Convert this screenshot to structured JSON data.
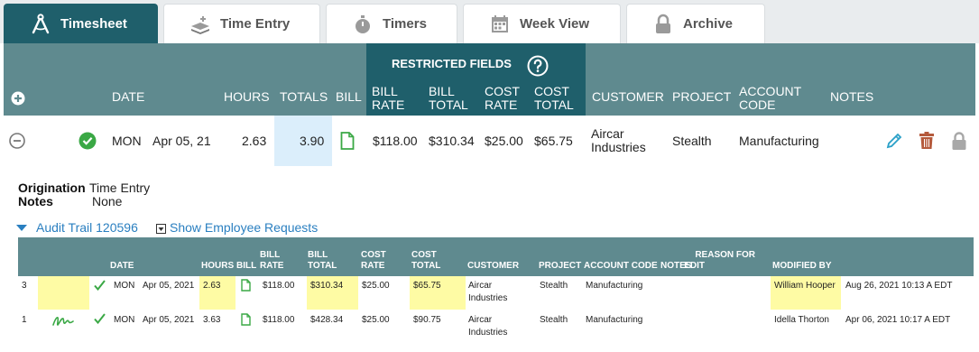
{
  "tabs": [
    {
      "label": "Timesheet",
      "icon": "compass-icon",
      "active": true
    },
    {
      "label": "Time Entry",
      "icon": "time-entry-icon",
      "active": false
    },
    {
      "label": "Timers",
      "icon": "stopwatch-icon",
      "active": false
    },
    {
      "label": "Week View",
      "icon": "calendar-icon",
      "active": false
    },
    {
      "label": "Archive",
      "icon": "lock-icon",
      "active": false
    }
  ],
  "header": {
    "restricted_title": "RESTRICTED FIELDS",
    "columns": {
      "date": "DATE",
      "hours": "HOURS",
      "totals": "TOTALS",
      "bill": "BILL",
      "bill_rate_1": "BILL",
      "bill_rate_2": "RATE",
      "bill_total_1": "BILL",
      "bill_total_2": "TOTAL",
      "cost_rate_1": "COST",
      "cost_rate_2": "RATE",
      "cost_total_1": "COST",
      "cost_total_2": "TOTAL",
      "customer": "CUSTOMER",
      "project": "PROJECT",
      "account_code_1": "ACCOUNT",
      "account_code_2": "CODE",
      "notes": "NOTES"
    }
  },
  "entry": {
    "day": "MON",
    "date": "Apr 05, 21",
    "hours": "2.63",
    "totals": "3.90",
    "bill_rate": "$118.00",
    "bill_total": "$310.34",
    "cost_rate": "$25.00",
    "cost_total": "$65.75",
    "customer_1": "Aircar",
    "customer_2": "Industries",
    "project": "Stealth",
    "account_code": "Manufacturing"
  },
  "details": {
    "origination_label": "Origination",
    "origination_value": "Time Entry",
    "notes_label": "Notes",
    "notes_value": "None",
    "audit_trail_link": "Audit Trail 120596",
    "employee_requests_link": "Show Employee Requests"
  },
  "audit": {
    "columns": {
      "date": "DATE",
      "hours": "HOURS",
      "bill": "BILL",
      "bill_rate_1": "BILL",
      "bill_rate_2": "RATE",
      "bill_total_1": "BILL",
      "bill_total_2": "TOTAL",
      "cost_rate_1": "COST",
      "cost_rate_2": "RATE",
      "cost_total_1": "COST",
      "cost_total_2": "TOTAL",
      "customer": "CUSTOMER",
      "project": "PROJECT",
      "account_code": "ACCOUNT CODE",
      "notes": "NOTES",
      "reason_1": "REASON FOR",
      "reason_2": "EDIT",
      "modified_by": "MODIFIED BY"
    },
    "rows": [
      {
        "num": "3",
        "day": "MON",
        "date": "Apr 05, 2021",
        "hours": "2.63",
        "bill_rate": "$118.00",
        "bill_total": "$310.34",
        "cost_rate": "$25.00",
        "cost_total": "$65.75",
        "customer_1": "Aircar",
        "customer_2": "Industries",
        "project": "Stealth",
        "account_code": "Manufacturing",
        "modified_by": "William Hooper",
        "modified_at": "Aug 26, 2021 10:13 A EDT"
      },
      {
        "num": "1",
        "day": "MON",
        "date": "Apr 05, 2021",
        "hours": "3.63",
        "bill_rate": "$118.00",
        "bill_total": "$428.34",
        "cost_rate": "$25.00",
        "cost_total": "$90.75",
        "customer_1": "Aircar",
        "customer_2": "Industries",
        "project": "Stealth",
        "account_code": "Manufacturing",
        "modified_by": "Idella Thorton",
        "modified_at": "Apr 06, 2021 10:17 A EDT"
      }
    ]
  },
  "colors": {
    "tab_active": "#1f5f6b",
    "header": "#5f8a8f",
    "restricted": "#1f5f6b",
    "highlight": "#fefba4",
    "totals_cell": "#dbeefb",
    "approved": "#3aa845",
    "link": "#2a7fc0",
    "edit": "#2aa0c8",
    "delete": "#b55a3c",
    "lock": "#999999"
  }
}
